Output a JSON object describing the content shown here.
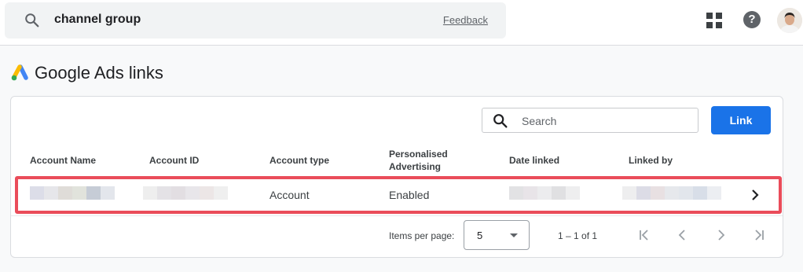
{
  "header": {
    "search_query": "channel group",
    "feedback_label": "Feedback"
  },
  "page": {
    "title": "Google Ads links"
  },
  "table": {
    "search_placeholder": "Search",
    "link_button_label": "Link",
    "columns": {
      "account_name": "Account Name",
      "account_id": "Account ID",
      "account_type": "Account type",
      "personalised_line1": "Personalised",
      "personalised_line2": "Advertising",
      "date_linked": "Date linked",
      "linked_by": "Linked by"
    },
    "rows": [
      {
        "account_type": "Account",
        "personalised_advertising": "Enabled"
      }
    ]
  },
  "pagination": {
    "items_per_page_label": "Items per page:",
    "items_per_page_value": "5",
    "range_label": "1 – 1 of 1"
  },
  "colors": {
    "primary": "#1a73e8",
    "highlight": "#ea4c5a"
  }
}
